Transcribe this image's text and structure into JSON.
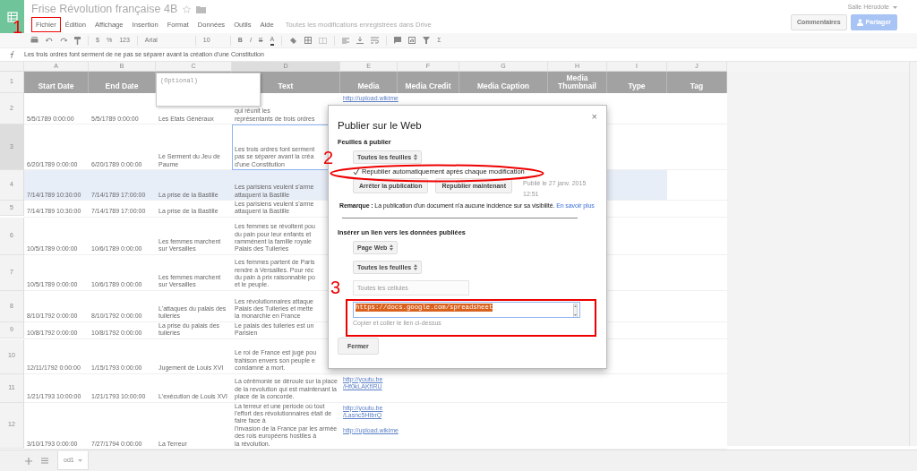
{
  "app": {
    "title": "Frise Révolution française 4B",
    "save_status": "Toutes les modifications enregistrées dans Drive",
    "user": "Salle Hérodote"
  },
  "menu": [
    {
      "label": "Fichier",
      "highlighted": true
    },
    {
      "label": "Édition",
      "highlighted": false
    },
    {
      "label": "Affichage",
      "highlighted": false
    },
    {
      "label": "Insertion",
      "highlighted": false
    },
    {
      "label": "Format",
      "highlighted": false
    },
    {
      "label": "Données",
      "highlighted": false
    },
    {
      "label": "Outils",
      "highlighted": false
    },
    {
      "label": "Aide",
      "highlighted": false
    }
  ],
  "header_buttons": [
    {
      "label": "Commentaires",
      "kind": "plain"
    },
    {
      "label": "Partager",
      "kind": "primary"
    }
  ],
  "toolbar": {
    "currency": "$",
    "percent": "%",
    "number_format": "123",
    "font": "Arial",
    "font_size": "10",
    "bold": "B",
    "italic": "I",
    "strike": "S",
    "text_color": "A",
    "functions": "Σ"
  },
  "formula_bar": {
    "content": "Les trois ordres font serment de ne pas se séparer avant la création d'une Constitution"
  },
  "columns": [
    {
      "letter": "A",
      "active": false
    },
    {
      "letter": "B",
      "active": false
    },
    {
      "letter": "C",
      "active": false
    },
    {
      "letter": "D",
      "active": true
    },
    {
      "letter": "E",
      "active": false
    },
    {
      "letter": "F",
      "active": false
    },
    {
      "letter": "G",
      "active": false
    },
    {
      "letter": "H",
      "active": false
    },
    {
      "letter": "I",
      "active": false
    },
    {
      "letter": "J",
      "active": false
    }
  ],
  "header_row": {
    "number": "1",
    "cells": {
      "A": "Start Date",
      "B": "End Date",
      "D": "Text",
      "E": "Media",
      "F": "Media Credit",
      "G": "Media Caption",
      "H": "Media\nThumbnail",
      "I": "Type",
      "J": "Tag"
    }
  },
  "note": {
    "text": "(Optional)"
  },
  "rows": [
    {
      "number": "2",
      "highlighted": false,
      "active": false,
      "cells": {
        "A": "5/5/1789 0:00:00",
        "B": "5/5/1789 0:00:00",
        "C": "Les Etats Généraux",
        "D": "qui réunit les\nreprésentants de trois ordres",
        "E": "http://upload.wikime"
      }
    },
    {
      "number": "3",
      "highlighted": false,
      "active": true,
      "cells": {
        "A": "6/20/1789 0:00:00",
        "B": "6/20/1789 0:00:00",
        "C": "Le Serment du Jeu de\nPaume",
        "D": "Les trois ordres font serment\npas se séparer avant la créa\nd'une Constitution"
      }
    },
    {
      "number": "4",
      "highlighted": true,
      "active": false,
      "cells": {
        "A": "7/14/1789 10:30:00",
        "B": "7/14/1789 17:00:00",
        "C": "La prise de la Bastille",
        "D": "Les parisiens veulent s'arme\nattaquent la Bastille"
      }
    },
    {
      "number": "5",
      "highlighted": false,
      "active": false,
      "cells": {
        "A": "7/14/1789 10:30:00",
        "B": "7/14/1789 17:00:00",
        "C": "La prise de la Bastille",
        "D": "Les parisiens veulent s'arme\nattaquent la Bastille"
      }
    },
    {
      "number": "6",
      "highlighted": false,
      "active": false,
      "cells": {
        "A": "10/5/1789 0:00:00",
        "B": "10/6/1789 0:00:00",
        "C": "Les femmes marchent\nsur Versailles",
        "D": "Les femmes se révoltent pou\ndu pain pour leur enfants et\nramménent la famille royale\nPalais des Tuileries"
      }
    },
    {
      "number": "7",
      "highlighted": false,
      "active": false,
      "cells": {
        "A": "10/5/1789 0:00:00",
        "B": "10/6/1789 0:00:00",
        "C": "Les femmes marchent\nsur Versailles",
        "D": "Les femmes partent de Paris\nrendre à Versailles. Pour réc\ndu pain à prix raisonnable po\net le peuple."
      }
    },
    {
      "number": "8",
      "highlighted": false,
      "active": false,
      "cells": {
        "A": "8/10/1792 0:00:00",
        "B": "8/10/1792 0:00:00",
        "C": "L'attaques du palais des\ntuileries",
        "D": "Les révolutionnaires attaque\nPalais des Tuileries et mette\nla monarchie en France"
      }
    },
    {
      "number": "9",
      "highlighted": false,
      "active": false,
      "cells": {
        "A": "10/8/1792 0:00:00",
        "B": "10/8/1792 0:00:00",
        "C": "La prise du palais des\ntuileries",
        "D": "Le palais des tuileries est un\nParisien"
      }
    },
    {
      "number": "10",
      "highlighted": false,
      "active": false,
      "cells": {
        "A": "12/11/1792 0:00:00",
        "B": "1/15/1793 0:00:00",
        "C": "Jugement de Louis XVI",
        "D": "Le roi de France est jugé pou\ntrahison envers son peuple e\ncondamné a mort."
      }
    },
    {
      "number": "11",
      "highlighted": false,
      "active": false,
      "cells": {
        "A": "1/21/1793 10:00:00",
        "B": "1/21/1793 10:00:00",
        "C": "L'exécution de Louis XVI",
        "D": "La cérémonie se déroule sur la place\nde la revolution qui est maintenant la\nplace de la concorde.",
        "E": "http://youtu.be\n/Hf0kLAKfIRU"
      }
    },
    {
      "number": "12",
      "highlighted": false,
      "active": false,
      "cells": {
        "A": "3/10/1793 0:00:00",
        "B": "7/27/1794 0:00:00",
        "C": "La Terreur",
        "D": "La terreur et une periode où tout\nl'effort des révolutionnaires était de\nfaire face à\nl'invasion de la France par les armée\ndes rois européens hostiles à\nla révolution.",
        "E": "http://youtu.be\n/Lasnc5HtbrQ\n\nhttp://upload.wikime"
      }
    }
  ],
  "sheet_tabs": [
    {
      "label": "od1",
      "selected": true
    }
  ],
  "dialog": {
    "title": "Publier sur le Web",
    "close": "×",
    "publish_section": {
      "heading": "Feuilles à publier",
      "select": "Toutes les feuilles",
      "checkbox": {
        "label": "Republier automatiquement après chaque modification",
        "checked": true
      },
      "buttons": [
        "Arrêter la publication",
        "Republier maintenant"
      ],
      "status": "Publié le 27 janv. 2015 12:51",
      "remark": "**Remarque :** La publication d'un document n'a aucune incidence sur sa visibilité.",
      "link": "En savoir plus"
    },
    "link_section": {
      "heading": "Insérer un lien vers les données publiées",
      "selects": [
        "Page Web",
        "Toutes les feuilles"
      ],
      "range_field": {
        "placeholder": "Toutes les cellules",
        "disabled": true
      },
      "url": "https://docs.google.com/spreadsheet",
      "hint": "Copier et coller le lien ci-dessus"
    },
    "close_button": "Fermer"
  },
  "annotations": [
    {
      "number": "1",
      "kind": "label"
    },
    {
      "number": "2",
      "kind": "ellipse"
    },
    {
      "number": "3",
      "kind": "box"
    }
  ]
}
